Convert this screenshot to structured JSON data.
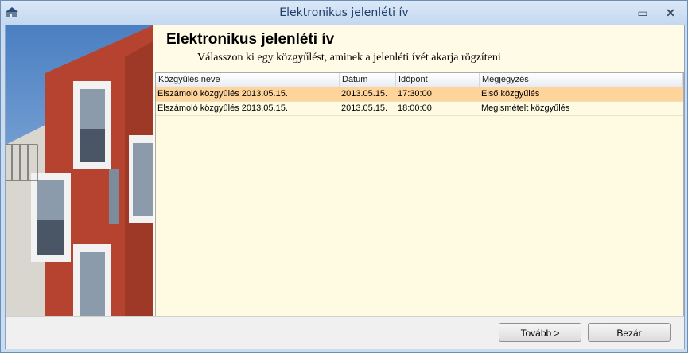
{
  "window": {
    "title": "Elektronikus jelenléti ív"
  },
  "titlebar_buttons": {
    "minimize": "–",
    "maximize": "▭",
    "close": "✕"
  },
  "content": {
    "heading": "Elektronikus jelenléti ív",
    "subtitle": "Válasszon ki egy közgyűlést, aminek a jelenléti ívét akarja rögzíteni"
  },
  "list": {
    "columns": [
      "Közgyűlés neve",
      "Dátum",
      "Időpont",
      "Megjegyzés"
    ],
    "rows": [
      {
        "name": "Elszámoló közgyűlés 2013.05.15.",
        "date": "2013.05.15.",
        "time": "17:30:00",
        "note": "Első közgyűlés",
        "selected": true
      },
      {
        "name": "Elszámoló közgyűlés 2013.05.15.",
        "date": "2013.05.15.",
        "time": "18:00:00",
        "note": "Megismételt közgyűlés",
        "selected": false
      }
    ]
  },
  "buttons": {
    "next": "Tovább >",
    "close": "Bezár"
  },
  "colors": {
    "selected_row": "#ffd49a",
    "list_bg": "#fffbe3",
    "brick": "#b5432f"
  }
}
